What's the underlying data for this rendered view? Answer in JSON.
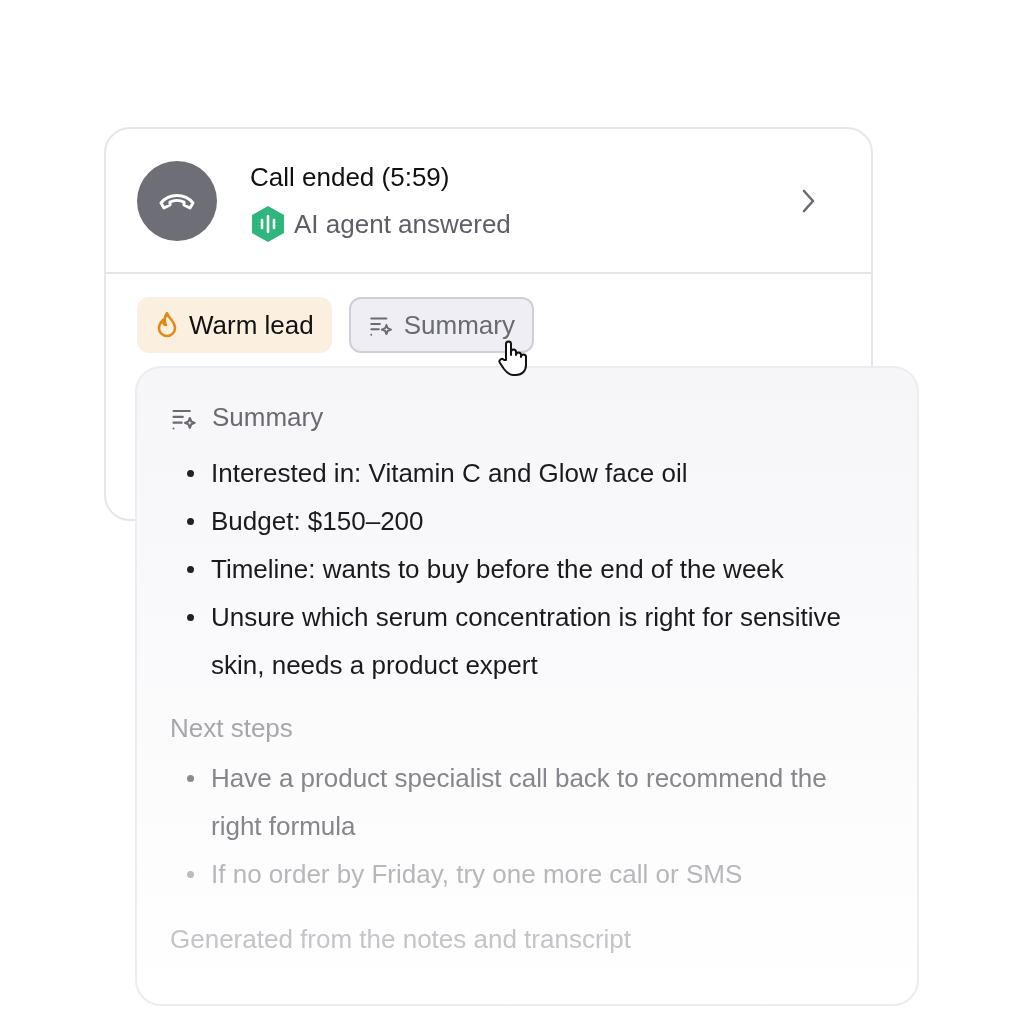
{
  "call": {
    "title": "Call ended (5:59)",
    "subtitle": "AI agent answered"
  },
  "tags": [
    {
      "kind": "lead",
      "label": "Warm lead"
    },
    {
      "kind": "toggle",
      "label": "Summary",
      "selected": true
    }
  ],
  "summary": {
    "title": "Summary",
    "points": [
      "Interested in: Vitamin C and Glow face oil",
      "Budget: $150–200",
      "Timeline: wants to buy before the end of the week",
      "Unsure which serum concentration is right for sensitive skin, needs a product expert"
    ],
    "next_steps_title": "Next steps",
    "next_steps": [
      "Have a product specialist call back to recommend the right formula",
      "If no order by Friday, try one more call or SMS"
    ],
    "footer": "Generated from the notes and transcript"
  }
}
